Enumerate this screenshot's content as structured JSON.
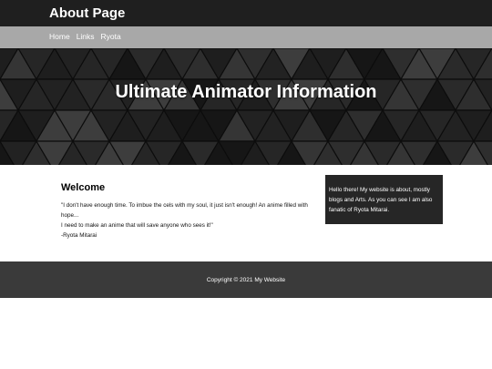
{
  "header": {
    "site_title": "About Page"
  },
  "nav": {
    "items": [
      {
        "label": "Home"
      },
      {
        "label": "Links"
      },
      {
        "label": "Ryota"
      }
    ]
  },
  "hero": {
    "title": "Ultimate Animator Information"
  },
  "main": {
    "heading": "Welcome",
    "quote_lines": [
      "\"I don't have enough time. To imbue the cels with my soul, it just isn't enough! An anime filled with hope...",
      "I need to make an anime that will save anyone who sees it!\"",
      "-Ryota Mitarai"
    ]
  },
  "aside": {
    "text": "Hello there! My website is about, mostly blogs and Arts. As you can see I am also fanatic of Ryota Mitarai."
  },
  "footer": {
    "text": "Copyright © 2021 My Website"
  },
  "colors": {
    "topbar": "#1f1f1f",
    "navbar": "#a8a8a8",
    "aside": "#262626",
    "footer": "#3a3a3a"
  }
}
